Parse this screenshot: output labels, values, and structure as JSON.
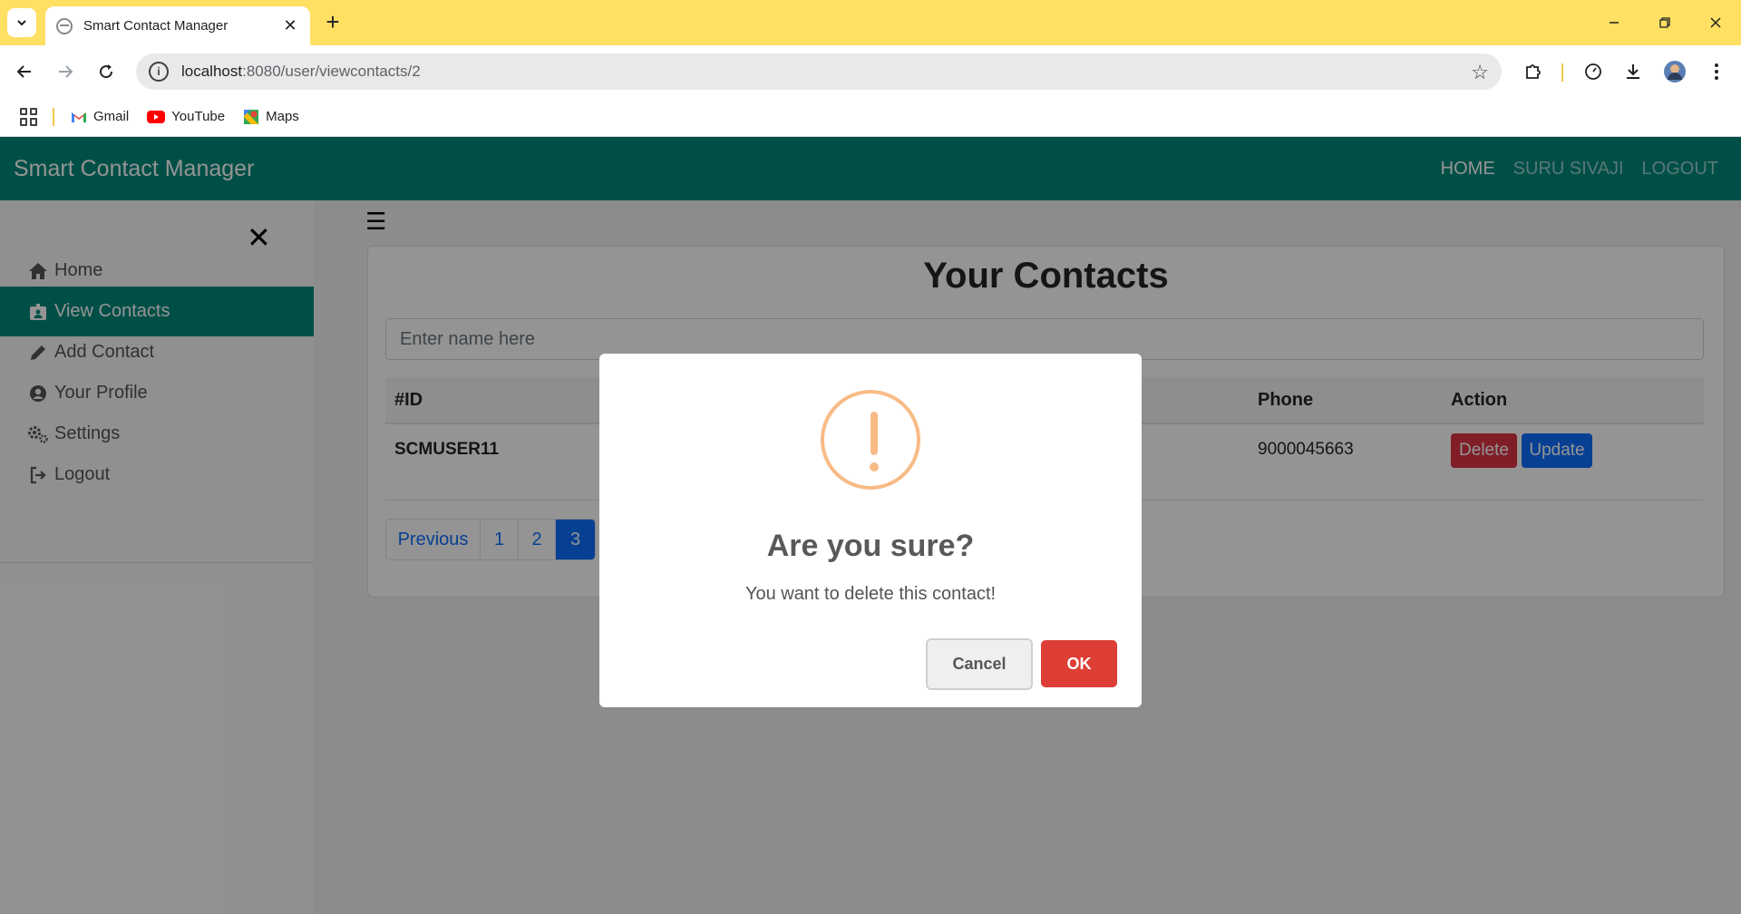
{
  "browser": {
    "tab_title": "Smart Contact Manager",
    "url_host": "localhost",
    "url_path": ":8080/user/viewcontacts/2",
    "bookmarks": [
      {
        "label": "Gmail",
        "icon": "gmail-icon"
      },
      {
        "label": "YouTube",
        "icon": "youtube-icon"
      },
      {
        "label": "Maps",
        "icon": "maps-icon"
      }
    ],
    "chrome_color": "#ffe063"
  },
  "app": {
    "brand": "Smart Contact Manager",
    "nav": [
      "HOME",
      "SURU SIVAJI",
      "LOGOUT"
    ],
    "accent": "#00897b"
  },
  "sidebar": {
    "items": [
      {
        "label": "Home",
        "icon": "home-icon"
      },
      {
        "label": "View Contacts",
        "icon": "contact-card-icon",
        "active": true
      },
      {
        "label": "Add Contact",
        "icon": "pencil-icon"
      },
      {
        "label": "Your Profile",
        "icon": "user-circle-icon"
      },
      {
        "label": "Settings",
        "icon": "gears-icon"
      },
      {
        "label": "Logout",
        "icon": "logout-icon"
      }
    ]
  },
  "main": {
    "title": "Your Contacts",
    "search_placeholder": "Enter name here",
    "table": {
      "headers": [
        "#ID",
        "Phone",
        "Action"
      ],
      "rows": [
        {
          "id": "SCMUSER11",
          "phone": "9000045663"
        }
      ],
      "delete_label": "Delete",
      "update_label": "Update"
    },
    "pagination": [
      "Previous",
      "1",
      "2",
      "3"
    ],
    "current_page": "3"
  },
  "dialog": {
    "title": "Are you sure?",
    "text": "You want to delete this contact!",
    "cancel_label": "Cancel",
    "ok_label": "OK",
    "icon": "warning-icon",
    "confirm_color": "#dd3e36"
  }
}
